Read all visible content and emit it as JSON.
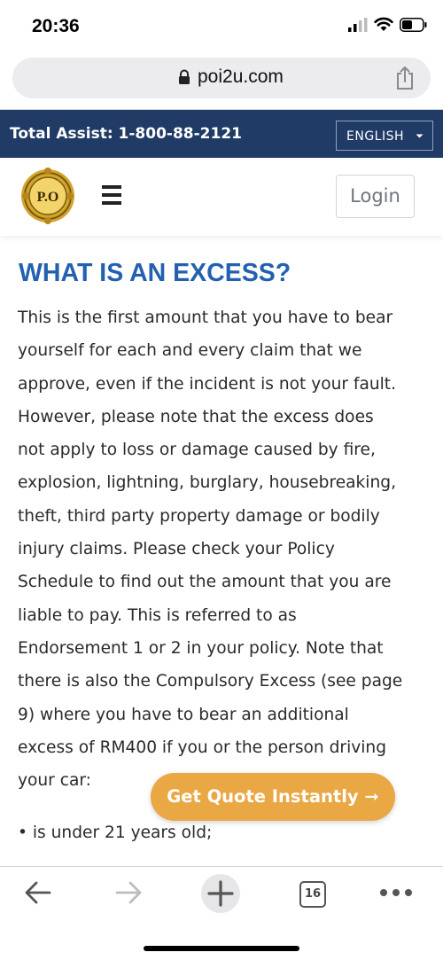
{
  "status_bar": {
    "time": "20:36",
    "icons": [
      "signal-icon",
      "wifi-icon",
      "battery-icon"
    ]
  },
  "browser": {
    "url": "poi2u.com",
    "tab_count": "16",
    "toolbar_icons": [
      "back-arrow-icon",
      "forward-arrow-icon",
      "new-tab-plus-icon",
      "tabs-icon",
      "more-dots-icon"
    ]
  },
  "assist_bar": {
    "text": "Total Assist: 1-800-88-2121",
    "language": "ENGLISH"
  },
  "header": {
    "logo_text": "P.O",
    "login_label": "Login"
  },
  "content": {
    "title": "WHAT IS AN EXCESS?",
    "lines": [
      "This is the first amount that you have to bear",
      "yourself for each and every claim that we",
      "approve, even if the incident is not your fault.",
      "However, please note that the excess does",
      "not apply to loss or damage caused by fire,",
      "explosion, lightning, burglary, housebreaking,",
      "theft, third party property damage or bodily",
      "injury claims. Please check your Policy",
      "Schedule to find out the amount that you are",
      "liable to pay. This is referred to as",
      "Endorsement 1 or 2 in your policy. Note that",
      "there is also the Compulsory Excess (see page",
      "9) where you have to bear an additional",
      "excess of RM400 if you or the person driving",
      "your car:"
    ],
    "bullet": "• is under 21 years old;"
  },
  "cta": {
    "label": "Get Quote Instantly ➞"
  },
  "colors": {
    "banner": "#1f3b66",
    "title": "#2361b0",
    "cta": "#eaa845",
    "logo_gold": "#d4a52c"
  }
}
